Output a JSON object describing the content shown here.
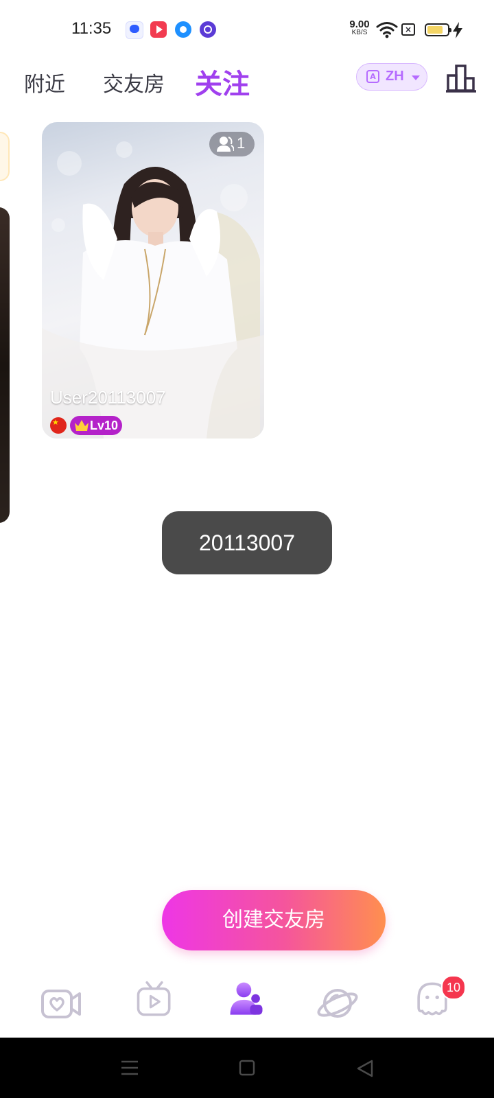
{
  "status_bar": {
    "time": "11:35",
    "net_speed_value": "9.00",
    "net_speed_unit": "KB/S",
    "notification_icons": [
      "baidu-icon",
      "video-app-icon",
      "qq-browser-icon",
      "vpn-icon"
    ],
    "battery_level": 0.8
  },
  "top_nav": {
    "tabs": [
      {
        "label": "附近",
        "active": false
      },
      {
        "label": "交友房",
        "active": false
      },
      {
        "label": "关注",
        "active": true
      }
    ],
    "language": {
      "code": "ZH",
      "icon": "translate-icon"
    },
    "rank_icon": "leaderboard-icon"
  },
  "room_card": {
    "username": "User20113007",
    "viewer_count": "1",
    "level": "Lv10",
    "country": "China"
  },
  "toast": {
    "text": "20113007"
  },
  "create_button": {
    "label": "创建交友房"
  },
  "bottom_nav": {
    "items": [
      {
        "name": "video",
        "icon": "video-heart-icon",
        "active": false
      },
      {
        "name": "live",
        "icon": "tv-play-icon",
        "active": false
      },
      {
        "name": "friends",
        "icon": "friends-icon",
        "active": true
      },
      {
        "name": "discover",
        "icon": "planet-icon",
        "active": false
      },
      {
        "name": "messages",
        "icon": "ghost-chat-icon",
        "active": false,
        "badge": "10"
      }
    ]
  },
  "colors": {
    "accent_purple": "#a040ee",
    "gradient_start": "#ee36e6",
    "gradient_end": "#ff8f4f",
    "badge_red": "#f5364e"
  }
}
